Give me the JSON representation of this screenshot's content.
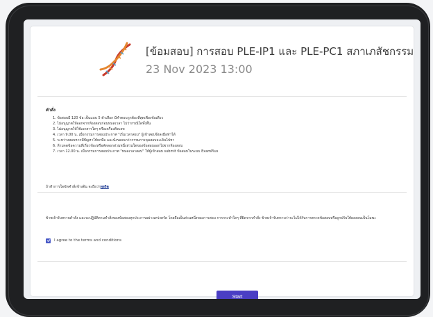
{
  "exam": {
    "title": "[ข้อมสอบ] การสอบ PLE-IP1 และ PLE-PC1 สภาเภสัชกรรม",
    "datetime": "23 Nov 2023 13:00"
  },
  "instructions": {
    "heading": "คำสั่ง",
    "items": [
      "1. ข้อสอบมี 120 ข้อ เป็นแบบ 5 ตัวเลือก มีคำตอบถูกต้องที่สุดเพียงข้อเดียว",
      "2. ไม่อนุญาตให้ออกจากห้องสอบก่อนหมดเวลา ไม่ว่ากรณีใดทั้งสิ้น",
      "3. ไม่อนุญาตให้ใช้เอกสารใดๆ หรือเครื่องคิดเลข",
      "4. เวลา 9.00 น. เมื่อกรรมการสอบประกาศ \"เริ่มเวลาสอบ\" ผู้เข้าสอบจึงลงมือทำได้",
      "5. ระหว่างสอบหากมีปัญหาให้ยกมือ และนั่งรอจนกว่ากรรมการคุมสอบจะเดินไปหา",
      "6. ห้ามจดข้อความที่เกี่ยวข้องหรือคัดลอกส่วนหนึ่งส่วนใดของข้อสอบออกไปจากห้องสอบ",
      "7. เวลา 12.00 น. เมื่อกรรมการสอบประกาศ \"หมดเวลาสอบ\" ให้ผู้เข้าสอบ submit  ข้อสอบในระบบ ExamPlus"
    ],
    "cheat_prefix": "ถ้าทำการใดขัดคำสั่งข้างต้น จะถือว่า",
    "cheat_link": "ทุจริต"
  },
  "agreement": {
    "paragraph": "ข้าพเจ้ารับทราบคำสั่ง และจะปฏิบัติตามคำสั่งของข้อสอบทุกประการอย่างเคร่งครัด โดยถือเป็นส่วนหนึ่งของการสอบ การกระทำใดๆ ที่ผิดจากคำสั่ง ข้าพเจ้ารับทราบว่าจะไม่ได้รับการตรวจข้อสอบหรือถูกปรับให้ผลสอบเป็นโมฆะ",
    "checkbox_label": "I agree to the terms and conditions",
    "checked": true
  },
  "actions": {
    "start_label": "Start"
  },
  "colors": {
    "accent": "#4a3ec4",
    "checkbox": "#4758c6",
    "link": "#0a2a8a",
    "dna_orange": "#e5862f",
    "dna_red": "#c73a2c"
  },
  "icons": {
    "logo": "dna-helix-icon",
    "checkbox": "checkmark-icon"
  }
}
